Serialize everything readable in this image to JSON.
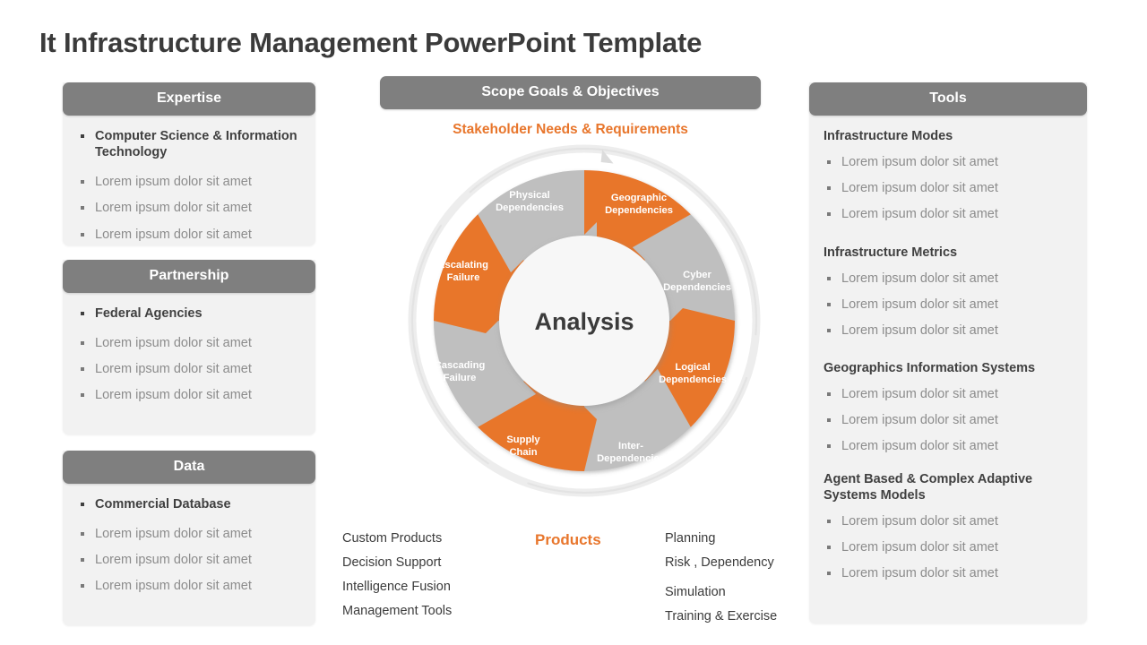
{
  "slide": {
    "title": "It Infrastructure Management PowerPoint Template"
  },
  "colors": {
    "accent_orange": "#e8762c",
    "header_gray": "#7f7f7f",
    "segment_gray": "#bfbfbf",
    "panel_bg": "#f2f2f2",
    "hub_bg": "#f7f7f7",
    "text_dark": "#3b3b3b",
    "text_muted": "#8c8c8c"
  },
  "left_panels": [
    {
      "header": "Expertise",
      "items": [
        {
          "text": "Computer Science & Information Technology",
          "lead": true
        },
        {
          "text": "Lorem ipsum dolor sit amet",
          "lead": false
        },
        {
          "text": "Lorem ipsum dolor sit amet",
          "lead": false
        },
        {
          "text": "Lorem ipsum dolor sit amet",
          "lead": false
        }
      ]
    },
    {
      "header": "Partnership",
      "items": [
        {
          "text": "Federal Agencies",
          "lead": true
        },
        {
          "text": "Lorem ipsum dolor sit amet",
          "lead": false
        },
        {
          "text": "Lorem ipsum dolor sit amet",
          "lead": false
        },
        {
          "text": "Lorem ipsum dolor sit amet",
          "lead": false
        }
      ]
    },
    {
      "header": "Data",
      "items": [
        {
          "text": "Commercial Database",
          "lead": true
        },
        {
          "text": "Lorem ipsum dolor sit amet",
          "lead": false
        },
        {
          "text": "Lorem ipsum dolor sit amet",
          "lead": false
        },
        {
          "text": "Lorem ipsum dolor sit amet",
          "lead": false
        }
      ]
    }
  ],
  "center": {
    "header": "Scope Goals & Objectives",
    "subtitle": "Stakeholder Needs & Requirements",
    "products_label": "Products",
    "bottom_left": [
      "Custom Products",
      "Decision Support",
      "Intelligence  Fusion",
      "Management  Tools"
    ],
    "bottom_right": [
      "Planning",
      "Risk , Dependency",
      "Simulation",
      "Training & Exercise"
    ]
  },
  "wheel": {
    "hub_label": "Analysis",
    "segments": [
      {
        "label_line1": "Geographic",
        "label_line2": "Dependencies",
        "color": "orange"
      },
      {
        "label_line1": "Cyber",
        "label_line2": "Dependencies",
        "color": "gray"
      },
      {
        "label_line1": "Logical",
        "label_line2": "Dependencies",
        "color": "orange"
      },
      {
        "label_line1": "Inter-",
        "label_line2": "Dependencies",
        "color": "gray"
      },
      {
        "label_line1": "Supply",
        "label_line2": "Chain",
        "color": "orange"
      },
      {
        "label_line1": "Cascading",
        "label_line2": "Failure",
        "color": "gray"
      },
      {
        "label_line1": "Escalating",
        "label_line2": "Failure",
        "color": "orange"
      },
      {
        "label_line1": "Physical",
        "label_line2": "Dependencies",
        "color": "gray"
      }
    ]
  },
  "right_panel": {
    "header": "Tools",
    "sections": [
      {
        "title": "Infrastructure  Modes",
        "items": [
          "Lorem ipsum dolor sit amet",
          "Lorem ipsum dolor sit amet",
          "Lorem ipsum dolor sit amet"
        ]
      },
      {
        "title": "Infrastructure  Metrics",
        "items": [
          "Lorem ipsum dolor sit amet",
          "Lorem ipsum dolor sit amet",
          "Lorem ipsum dolor sit amet"
        ]
      },
      {
        "title": "Geographics  Information Systems",
        "items": [
          "Lorem ipsum dolor sit amet",
          "Lorem ipsum dolor sit amet",
          "Lorem ipsum dolor sit amet"
        ]
      },
      {
        "title": "Agent Based & Complex Adaptive Systems Models",
        "items": [
          "Lorem ipsum dolor sit amet",
          "Lorem ipsum dolor sit amet",
          "Lorem ipsum dolor sit amet"
        ]
      }
    ]
  }
}
